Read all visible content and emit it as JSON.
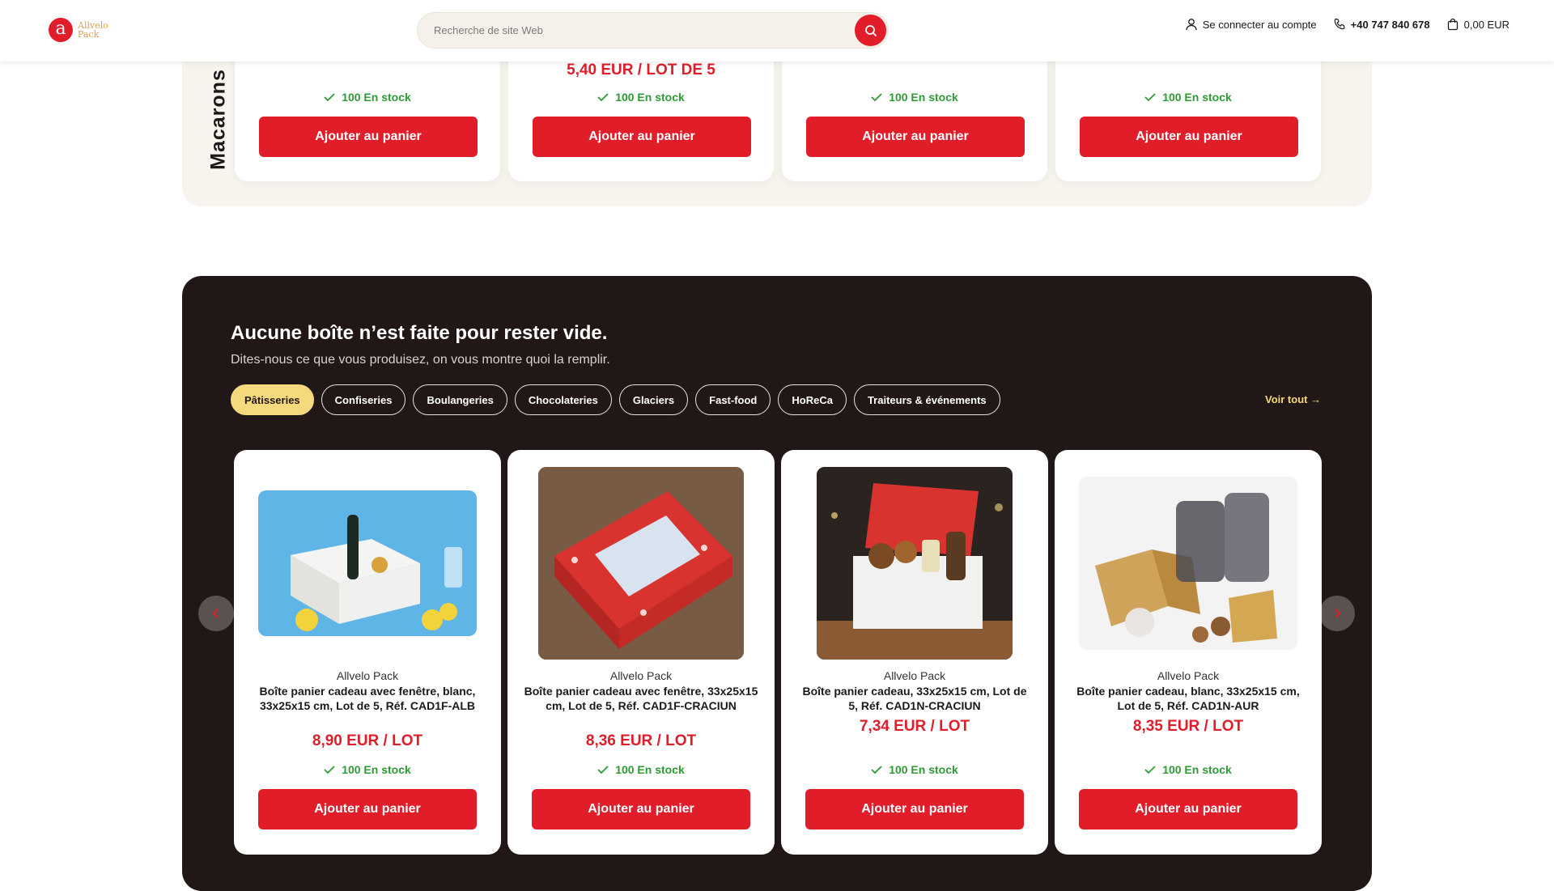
{
  "header": {
    "logo_line1": "Allvelo",
    "logo_line2": "Pack",
    "search_placeholder": "Recherche de site Web",
    "login_label": "Se connecter au compte",
    "phone": "+40 747 840 678",
    "cart_total": "0,00 EUR"
  },
  "top_section": {
    "vertical_title": "Macarons",
    "cards": [
      {
        "price": "",
        "stock": "100 En stock",
        "button": "Ajouter au panier"
      },
      {
        "price": "5,40 EUR / LOT DE 5",
        "stock": "100 En stock",
        "button": "Ajouter au panier"
      },
      {
        "price": "",
        "stock": "100 En stock",
        "button": "Ajouter au panier"
      },
      {
        "price": "",
        "stock": "100 En stock",
        "button": "Ajouter au panier"
      }
    ]
  },
  "dark_section": {
    "title": "Aucune boîte n’est faite pour rester vide.",
    "subtitle": "Dites-nous ce que vous produisez, on vous montre quoi la remplir.",
    "see_all": "Voir tout →",
    "pills": [
      "Pâtisseries",
      "Confiseries",
      "Boulangeries",
      "Chocolateries",
      "Glaciers",
      "Fast-food",
      "HoReCa",
      "Traiteurs & événements"
    ],
    "products": [
      {
        "brand": "Allvelo Pack",
        "name": "Boîte panier cadeau avec fenêtre, blanc, 33x25x15 cm, Lot de 5, Réf. CAD1F-ALB",
        "price": "8,90 EUR / LOT",
        "stock": "100 En stock",
        "button": "Ajouter au panier"
      },
      {
        "brand": "Allvelo Pack",
        "name": "Boîte panier cadeau avec fenêtre, 33x25x15 cm, Lot de 5, Réf. CAD1F-CRACIUN",
        "price": "8,36 EUR / LOT",
        "stock": "100 En stock",
        "button": "Ajouter au panier"
      },
      {
        "brand": "Allvelo Pack",
        "name": "Boîte panier cadeau, 33x25x15 cm, Lot de 5, Réf. CAD1N-CRACIUN",
        "price": "7,34 EUR / LOT",
        "stock": "100 En stock",
        "button": "Ajouter au panier"
      },
      {
        "brand": "Allvelo Pack",
        "name": "Boîte panier cadeau, blanc, 33x25x15 cm, Lot de 5, Réf. CAD1N-AUR",
        "price": "8,35 EUR / LOT",
        "stock": "100 En stock",
        "button": "Ajouter au panier"
      }
    ]
  },
  "colors": {
    "accent": "#e11d2a",
    "dark_bg": "#221717",
    "pill_active": "#f5d97c",
    "stock_green": "#2e9b36",
    "cream_bg": "#f7f4ee"
  }
}
